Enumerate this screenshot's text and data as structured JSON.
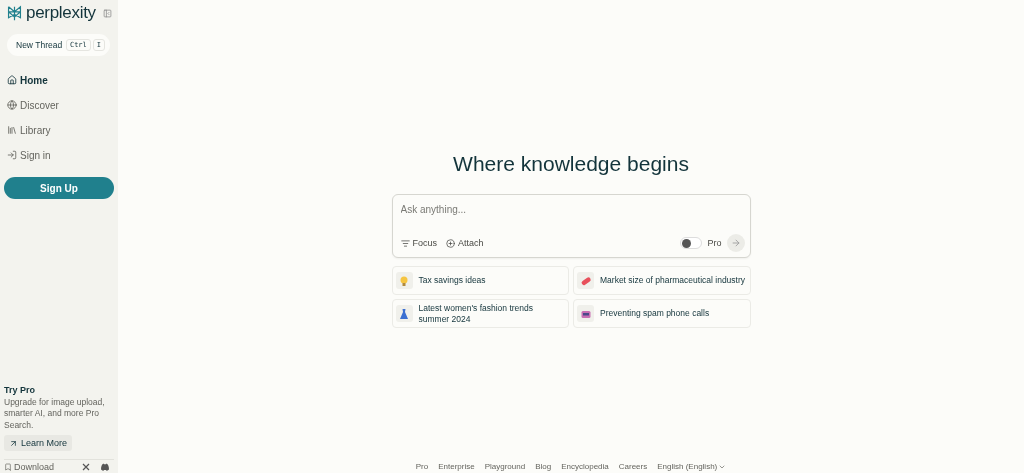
{
  "sidebar": {
    "logo": "perplexity",
    "new_thread": {
      "label": "New Thread",
      "keys": [
        "Ctrl",
        "I"
      ]
    },
    "nav": [
      {
        "label": "Home",
        "selected": true
      },
      {
        "label": "Discover",
        "selected": false
      },
      {
        "label": "Library",
        "selected": false
      },
      {
        "label": "Sign in",
        "selected": false
      }
    ],
    "signup": "Sign Up",
    "promo": {
      "title": "Try Pro",
      "text": "Upgrade for image upload, smarter AI, and more Pro Search.",
      "button": "Learn More"
    },
    "download": "Download"
  },
  "main": {
    "heading": "Where knowledge begins",
    "search": {
      "placeholder": "Ask anything...",
      "focus": "Focus",
      "attach": "Attach",
      "pro_label": "Pro",
      "pro_on": false
    },
    "suggestions": [
      {
        "text": "Tax savings ideas"
      },
      {
        "text": "Market size of pharmaceutical industry"
      },
      {
        "text": "Latest women's fashion trends summer 2024"
      },
      {
        "text": "Preventing spam phone calls"
      }
    ],
    "footer": [
      {
        "label": "Pro",
        "kind": "link"
      },
      {
        "label": "Enterprise",
        "kind": "link"
      },
      {
        "label": "Playground",
        "kind": "link"
      },
      {
        "label": "Blog",
        "kind": "link"
      },
      {
        "label": "Encyclopedia",
        "kind": "link"
      },
      {
        "label": "Careers",
        "kind": "link"
      },
      {
        "label": "English (English)",
        "kind": "language"
      }
    ]
  }
}
